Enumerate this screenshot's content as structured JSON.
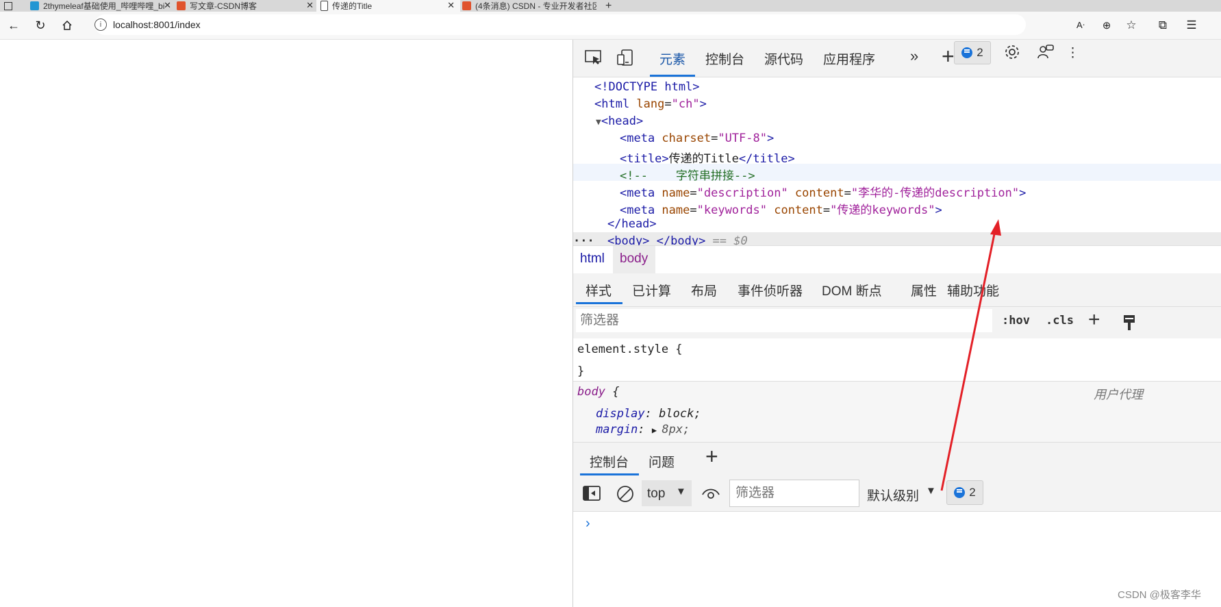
{
  "browser": {
    "tabs": [
      {
        "title": "2thymeleaf基础使用_哔哩哔哩_bi",
        "active": false
      },
      {
        "title": "写文章-CSDN博客",
        "active": false
      },
      {
        "title": "传递的Title",
        "active": true
      },
      {
        "title": "(4条消息) CSDN - 专业开发者社区",
        "active": false
      }
    ],
    "url": "localhost:8001/index"
  },
  "devtools": {
    "tabs": [
      "元素",
      "控制台",
      "源代码",
      "应用程序"
    ],
    "issues_count": "2",
    "dom": {
      "doctype": "<!DOCTYPE html>",
      "html_open": "<html",
      "lang_attr": " lang",
      "lang_value": "\"ch\"",
      "head_open": "<head>",
      "meta_charset_tag": "<meta",
      "charset_attr": " charset",
      "charset_value": "\"UTF-8\"",
      "title_open": "<title>",
      "title_text": "传递的Title",
      "title_close": "</title>",
      "comment": "<!--    字符串拼接-->",
      "meta1_tag": "<meta",
      "meta1_name_attr": " name",
      "meta1_name_value": "\"description\"",
      "meta1_content_attr": " content",
      "meta1_content_value": "\"李华的-传递的description\"",
      "meta2_tag": "<meta",
      "meta2_name_attr": " name",
      "meta2_name_value": "\"keywords\"",
      "meta2_content_attr": " content",
      "meta2_content_value": "\"传递的keywords\"",
      "head_close": "</head>",
      "body_open": "<body>",
      "body_close": " </body>",
      "selected_marker": " == $0",
      "ellipsis": "···"
    },
    "breadcrumbs": [
      "html",
      "body"
    ],
    "style_tabs": [
      "样式",
      "已计算",
      "布局",
      "事件侦听器",
      "DOM 断点",
      "属性",
      "辅助功能"
    ],
    "filter_placeholder": "筛选器",
    "hov": ":hov",
    "cls": ".cls",
    "styles": {
      "element_style_open": "element.style {",
      "close_brace": "}",
      "body_selector": "body",
      "body_brace": " {",
      "user_agent": "用户代理",
      "prop1_name": "display",
      "prop1_value": "block;",
      "prop2_name": "margin",
      "prop2_value": "8px;"
    },
    "drawer": {
      "tabs": [
        "控制台",
        "问题"
      ],
      "context": "top",
      "filter_placeholder": "筛选器",
      "level": "默认级别",
      "issues_count": "2"
    }
  },
  "watermark": "CSDN @极客李华",
  "colors": {
    "accent": "#1a73d9",
    "arrow": "#e32027"
  }
}
